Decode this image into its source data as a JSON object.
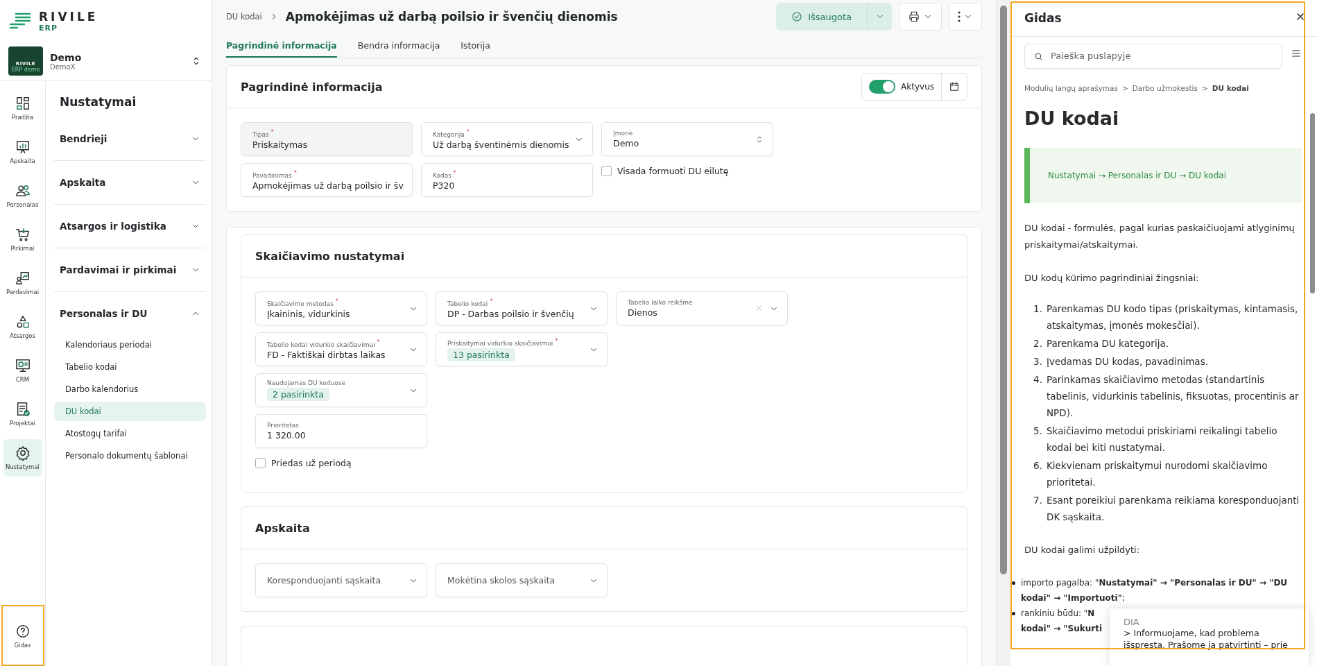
{
  "brand": {
    "name": "RIVILE",
    "sub": "ERP"
  },
  "company": {
    "logo_name": "RIVILE",
    "logo_sub": "ERP demo",
    "name": "Demo",
    "sub": "DemoX"
  },
  "rail": [
    {
      "label": "Pradžia",
      "selected": false
    },
    {
      "label": "Apskaita",
      "selected": false
    },
    {
      "label": "Personalas",
      "selected": false
    },
    {
      "label": "Pirkimai",
      "selected": false
    },
    {
      "label": "Pardavimai",
      "selected": false
    },
    {
      "label": "Atsargos",
      "selected": false
    },
    {
      "label": "CRM",
      "selected": false
    },
    {
      "label": "Projektai",
      "selected": false
    },
    {
      "label": "Nustatymai",
      "selected": true
    }
  ],
  "help": {
    "label": "Gidas"
  },
  "menu": {
    "title": "Nustatymai",
    "groups": [
      {
        "label": "Bendrieji",
        "expanded": false
      },
      {
        "label": "Apskaita",
        "expanded": false
      },
      {
        "label": "Atsargos ir logistika",
        "expanded": false
      },
      {
        "label": "Pardavimai ir pirkimai",
        "expanded": false
      },
      {
        "label": "Personalas ir DU",
        "expanded": true,
        "children": [
          {
            "label": "Kalendoriaus periodai",
            "selected": false
          },
          {
            "label": "Tabelio kodai",
            "selected": false
          },
          {
            "label": "Darbo kalendorius",
            "selected": false
          },
          {
            "label": "DU kodai",
            "selected": true
          },
          {
            "label": "Atostogų tarifai",
            "selected": false
          },
          {
            "label": "Personalo dokumentų šablonai",
            "selected": false
          }
        ]
      }
    ]
  },
  "header": {
    "breadcrumb": "DU kodai",
    "title": "Apmokėjimas už darbą poilsio ir švenčių dienomis",
    "save": "Išsaugota"
  },
  "tabs": [
    {
      "label": "Pagrindinė informacija",
      "selected": true
    },
    {
      "label": "Bendra informacija",
      "selected": false
    },
    {
      "label": "Istorija",
      "selected": false
    }
  ],
  "main_card": {
    "title": "Pagrindinė informacija",
    "active": {
      "label": "Aktyvus",
      "on": true
    },
    "rows": [
      [
        {
          "kind": "readonly",
          "label": "Tipas $^{*}$",
          "value": "Priskaitymas"
        },
        {
          "kind": "select",
          "label": "Kategorija $^{*}$",
          "value": "Už darbą šventinėmis dienomis"
        },
        {
          "kind": "spinner",
          "label": "Įmonė",
          "value": "Demo"
        }
      ],
      [
        {
          "kind": "text",
          "label": "Pavadinimas $^{*}$",
          "value": "Apmokėjimas už darbą poilsio ir šv"
        },
        {
          "kind": "text",
          "label": "Kodas $^{*}$",
          "value": "P320"
        },
        {
          "kind": "checkbox",
          "label": "Visada formuoti DU eilutę",
          "checked": false
        }
      ]
    ]
  },
  "calc_card": {
    "title": "Skaičiavimo nustatymai",
    "rows": [
      [
        {
          "kind": "select",
          "label": "Skaičiavimo metodas $^{*}$",
          "value": "Įkaininis, vidurkinis"
        },
        {
          "kind": "select",
          "label": "Tabelio kodai $^{*}$",
          "value": "DP - Darbas poilsio ir švenčių"
        },
        {
          "kind": "clearable",
          "label": "Tabelio laiko reikšmė",
          "value": "Dienos"
        }
      ],
      [
        {
          "kind": "select",
          "label": "Tabelio kodai vidurkio skaičiavimui $^{*}$",
          "value": "FD - Faktiškai dirbtas laikas"
        },
        {
          "kind": "chips",
          "label": "Priskaitymai vidurkio skaičiavimui $^{*}$",
          "value": "13 pasirinkta"
        }
      ],
      [
        {
          "kind": "chips",
          "label": "Naudojamas DU koduose",
          "value": "2 pasirinkta"
        }
      ],
      [
        {
          "kind": "text",
          "label": "Prioritetas",
          "value": "1 320.00"
        }
      ],
      [
        {
          "kind": "checkbox",
          "label": "Priedas už periodą",
          "checked": false
        }
      ]
    ]
  },
  "account_card": {
    "title": "Apskaita",
    "rows": [
      [
        {
          "kind": "select",
          "placeholder": "Koresponduojanti sąskaita"
        },
        {
          "kind": "select",
          "placeholder": "Mokėtina skolos sąskaita"
        }
      ]
    ]
  },
  "guide": {
    "title": "Gidas",
    "search_placeholder": "Paieška puslapyje",
    "breadcrumb": [
      "Modulių langų aprašymas",
      ">",
      "Darbo užmokestis",
      ">",
      "DU kodai"
    ],
    "heading": "DU kodai",
    "note": "Nustatymai → Personalas ir DU → DU kodai",
    "intro": "DU kodai - formulės, pagal kurias paskaičiuojami atlyginimų priskaitymai/atskaitymai.",
    "steps_title": "DU kodų kūrimo pagrindiniai žingsniai:",
    "steps": [
      {
        "marker": "1.",
        "text": "Parenkamas DU kodo tipas (priskaitymas, kintamasis, atskaitymas, įmonės mokesčiai)."
      },
      {
        "marker": "2.",
        "text": "Parenkama DU kategorija."
      },
      {
        "marker": "3.",
        "text": "Įvedamas DU kodas, pavadinimas."
      },
      {
        "marker": "4.",
        "text": "Parinkamas skaičiavimo metodas (standartinis tabelinis, vidurkinis tabelinis, fiksuotas, procentinis ar NPD)."
      },
      {
        "marker": "5.",
        "text": "Skaičiavimo metodui priskiriami reikalingi tabelio kodai bei kiti nustatymai."
      },
      {
        "marker": "6.",
        "text": "Kiekvienam priskaitymui nurodomi skaičiavimo prioritetai."
      },
      {
        "marker": "7.",
        "text": "Esant poreikiui parenkama reikiama koresponduojanti DK sąskaita."
      }
    ],
    "fill_title": "DU kodai galimi užpildyti:",
    "bullets": [
      {
        "lines": [
          "importo pagalba: \"**Nustatymai\" → \"Personalas ir DU\" → \"DU kodai\" → \"Importuoti\"**;"
        ]
      },
      {
        "lines": [
          "rankiniu būdu: \"**N**",
          "**kodai\" → \"Sukurti**"
        ]
      }
    ]
  },
  "chat_popup": {
    "title": "DIA",
    "lines": [
      "> Informuojame, kad problema",
      "išspresta. Prašome ja patvirtinti – prie"
    ]
  }
}
